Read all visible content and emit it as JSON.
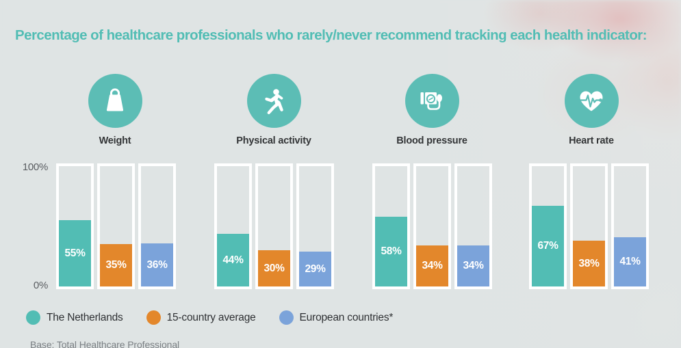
{
  "title": "Percentage of healthcare professionals who rarely/never recommend tracking each health indicator:",
  "footnote": "Base: Total Healthcare Professional",
  "colors": {
    "background": "#dfe4e4",
    "title": "#52bdb4",
    "icon_circle": "#5cbdb5",
    "netherlands": "#52bdb4",
    "average": "#e3872b",
    "european": "#7ba3da",
    "bar_track_border": "#ffffff",
    "axis_text": "#5a5d61",
    "category_label": "#333537"
  },
  "axis": {
    "top_label": "100%",
    "bottom_label": "0%",
    "min": 0,
    "max": 100
  },
  "categories": [
    {
      "label": "Weight",
      "icon": "weight-icon"
    },
    {
      "label": "Physical activity",
      "icon": "running-person-icon"
    },
    {
      "label": "Blood pressure",
      "icon": "blood-pressure-monitor-icon"
    },
    {
      "label": "Heart rate",
      "icon": "heart-pulse-icon"
    }
  ],
  "legend": [
    {
      "label": "The Netherlands",
      "color": "#52bdb4"
    },
    {
      "label": "15-country average",
      "color": "#e3872b"
    },
    {
      "label": "European countries*",
      "color": "#7ba3da"
    }
  ],
  "chart_data": {
    "type": "bar",
    "title": "Percentage of healthcare professionals who rarely/never recommend tracking each health indicator:",
    "xlabel": "",
    "ylabel": "",
    "ylim": [
      0,
      100
    ],
    "grid": false,
    "legend_position": "bottom-left",
    "value_suffix": "%",
    "categories": [
      "Weight",
      "Physical activity",
      "Blood pressure",
      "Heart rate"
    ],
    "series": [
      {
        "name": "The Netherlands",
        "color": "#52bdb4",
        "values": [
          55,
          44,
          58,
          67
        ],
        "labels": [
          "55%",
          "44%",
          "58%",
          "67%"
        ]
      },
      {
        "name": "15-country average",
        "color": "#e3872b",
        "values": [
          35,
          30,
          34,
          38
        ],
        "labels": [
          "35%",
          "30%",
          "34%",
          "38%"
        ]
      },
      {
        "name": "European countries*",
        "color": "#7ba3da",
        "values": [
          36,
          29,
          34,
          41
        ],
        "labels": [
          "36%",
          "29%",
          "34%",
          "41%"
        ]
      }
    ]
  }
}
